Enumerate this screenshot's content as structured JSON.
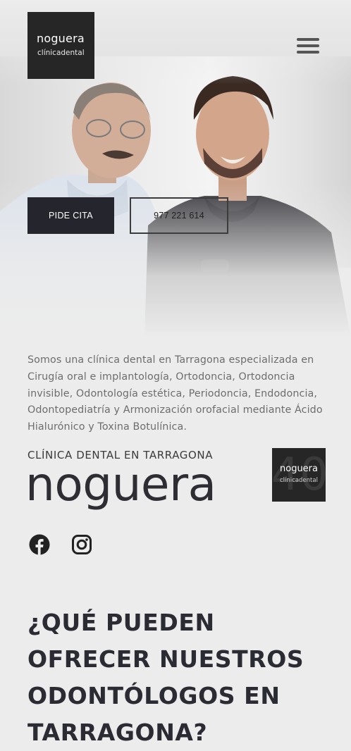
{
  "header": {
    "logo_name": "noguera",
    "logo_sub": "clínicadental"
  },
  "hero": {
    "cta_label": "PIDE CITA",
    "phone_label": "977 221 614"
  },
  "intro": {
    "text": "Somos una clínica dental en Tarragona especializada en Cirugía oral e implantología, Ortodoncia, Ortodoncia invisible, Odontología estética, Periodoncia, Endodoncia, Odontopediatría y Armonización orofacial mediante Ácido Hialurónico y Toxina Botulínica."
  },
  "brand": {
    "kicker": "CLÍNICA DENTAL EN TARRAGONA",
    "name": "noguera",
    "badge_number": "40",
    "badge_name": "noguera",
    "badge_sub": "clínicadental"
  },
  "social": {
    "icons": [
      "facebook-icon",
      "instagram-icon"
    ]
  },
  "section": {
    "heading": "¿QUÉ PUEDEN OFRECER NUESTROS ODONTÓLOGOS EN TARRAGONA?"
  },
  "colors": {
    "dark": "#25252e",
    "background": "#ececec",
    "body_text": "#6d6d6d"
  }
}
